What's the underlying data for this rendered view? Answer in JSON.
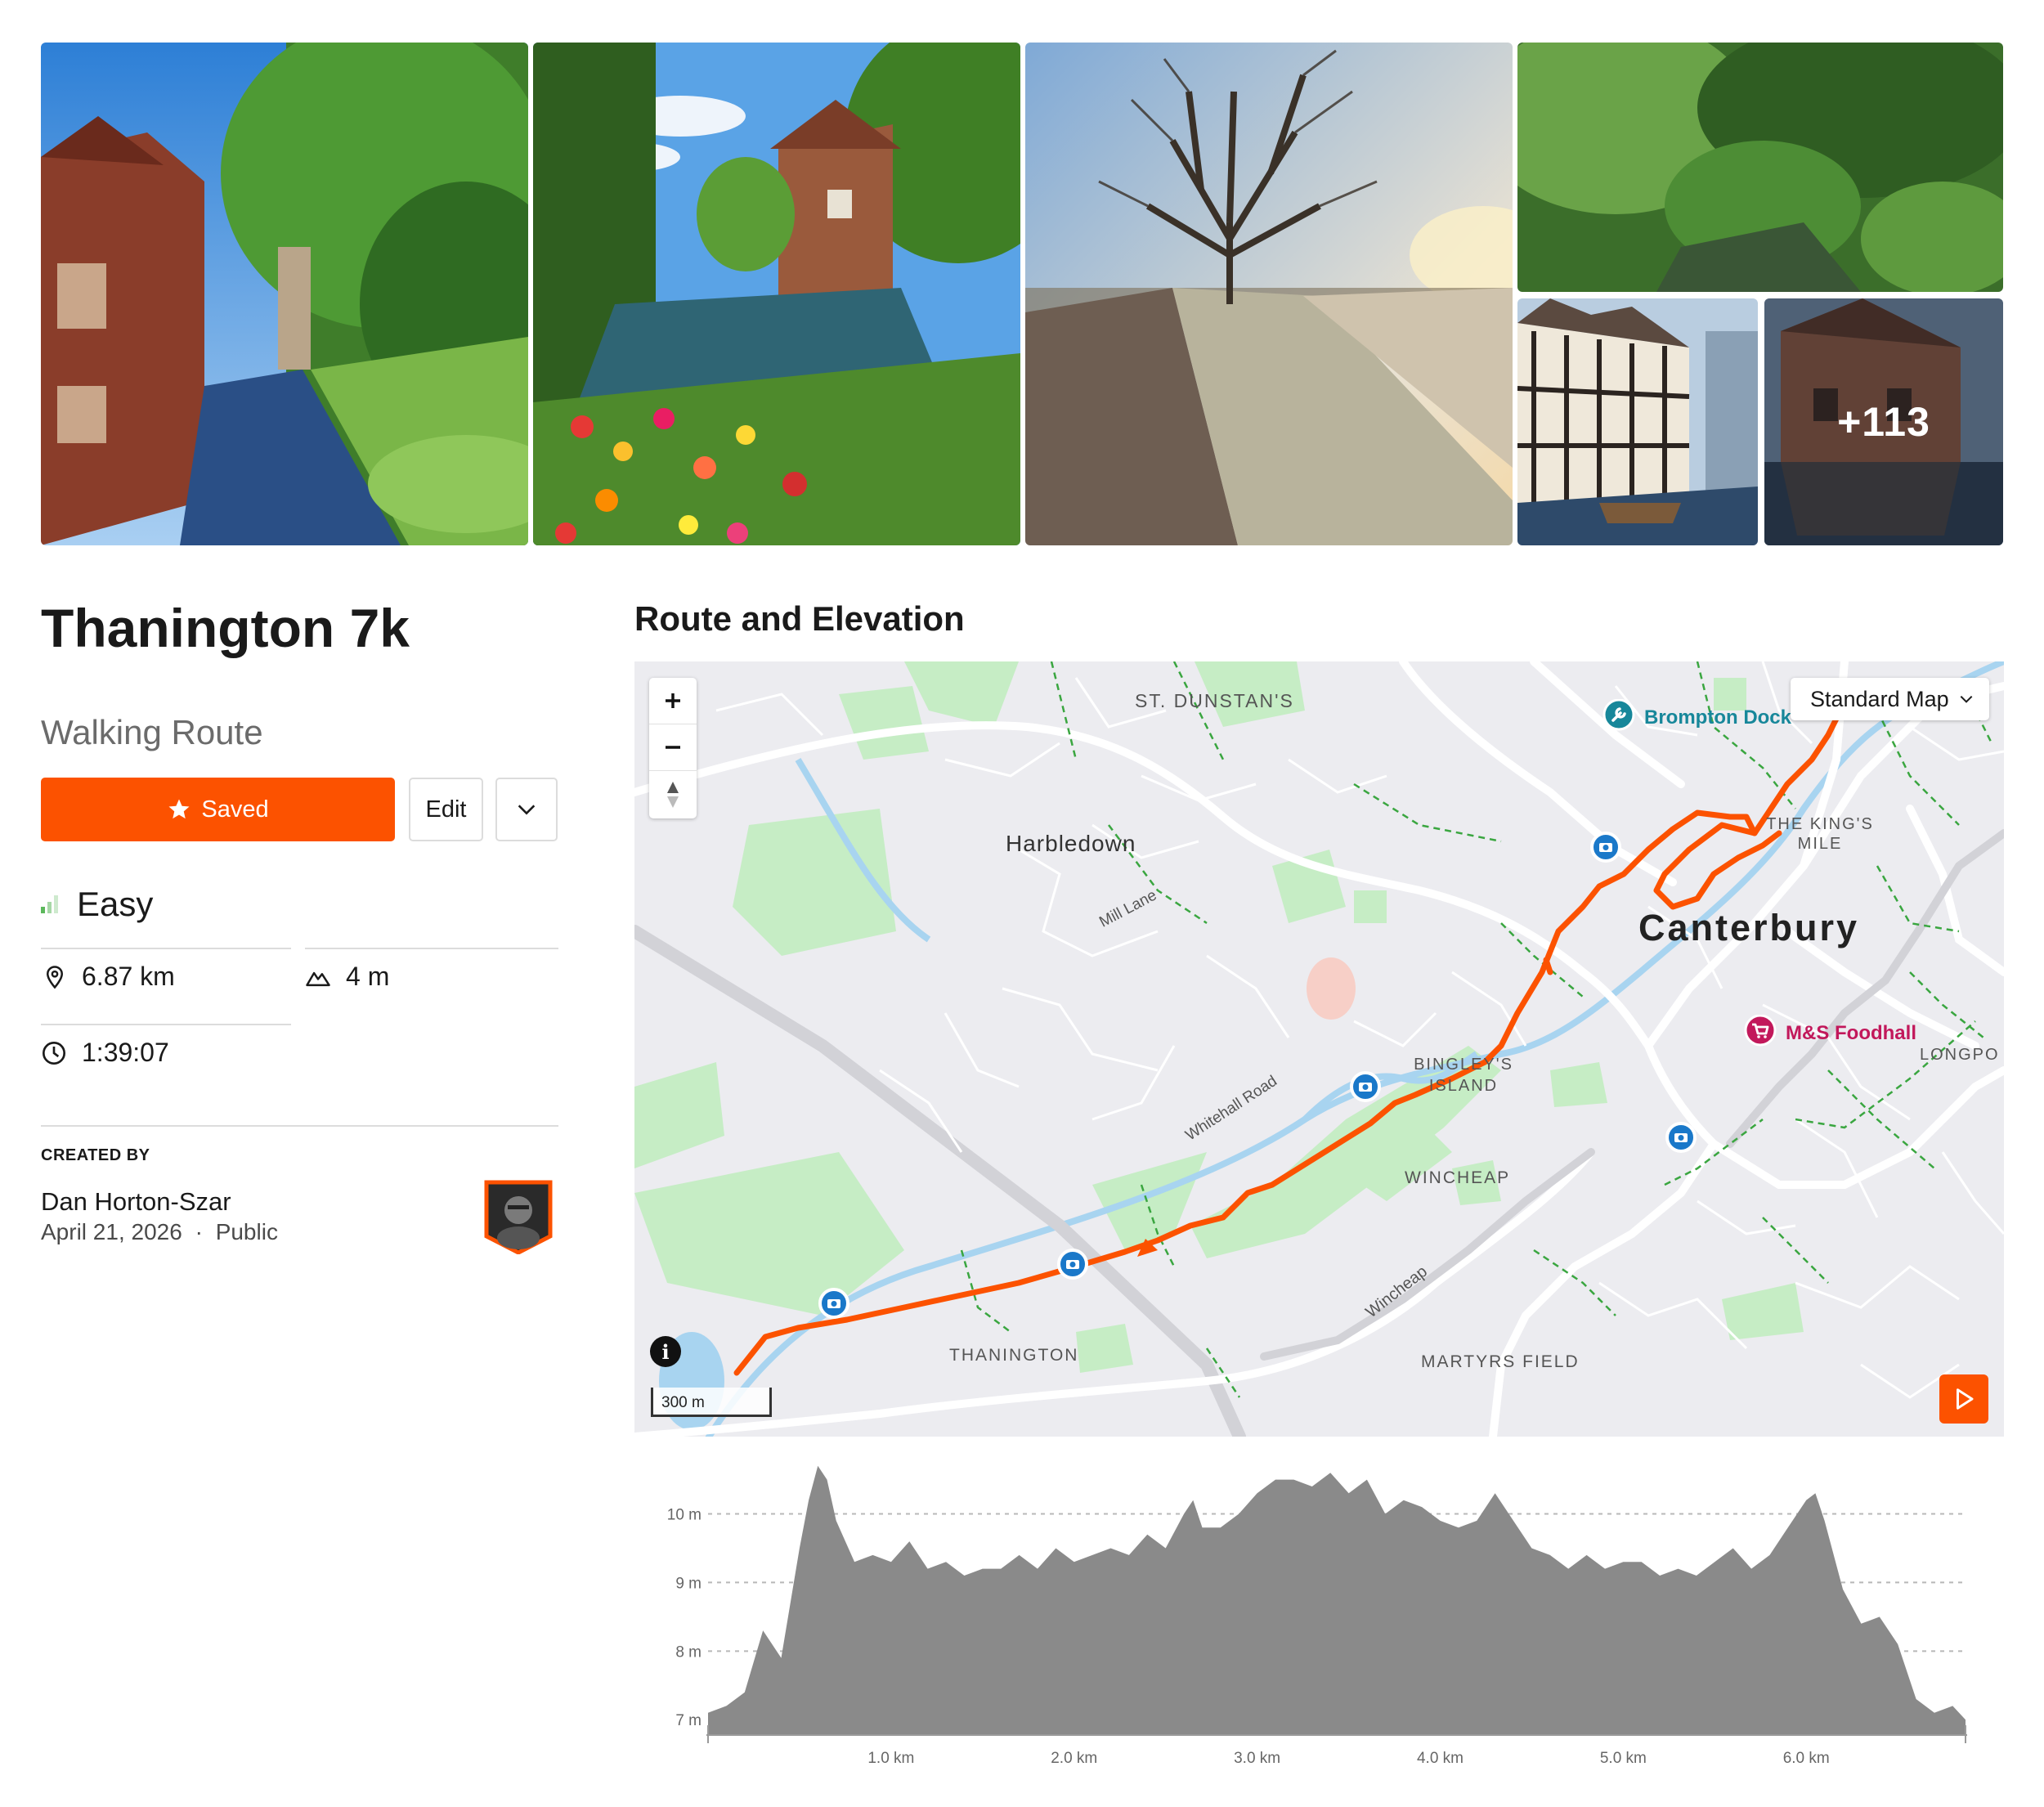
{
  "gallery": {
    "more_count": "+113",
    "photos": [
      {
        "alt_icon": "river-photo"
      },
      {
        "alt_icon": "garden-photo"
      },
      {
        "alt_icon": "tree-photo"
      },
      {
        "alt_icon": "stream-photo"
      },
      {
        "alt_icon": "tudor-house-photo"
      },
      {
        "alt_icon": "old-building-photo"
      }
    ]
  },
  "route": {
    "title": "Thanington 7k",
    "type": "Walking Route",
    "difficulty": "Easy",
    "distance": "6.87 km",
    "elevation_gain": "4 m",
    "duration": "1:39:07"
  },
  "actions": {
    "saved_label": "Saved",
    "edit_label": "Edit"
  },
  "creator": {
    "section_label": "CREATED BY",
    "name": "Dan Horton-Szar",
    "date": "April 21, 2026",
    "separator": "·",
    "visibility": "Public"
  },
  "map": {
    "section_title": "Route and Elevation",
    "style_label": "Standard Map",
    "scale_label": "300 m",
    "labels": {
      "st_dunstans": "ST. DUNSTAN'S",
      "harbledown": "Harbledown",
      "mill_lane": "Mill Lane",
      "canterbury": "Canterbury",
      "kings_mile": "THE KING'S MILE",
      "bingleys_island": "BINGLEY'S ISLAND",
      "whitehall_road": "Whitehall Road",
      "wincheap_area": "WINCHEAP",
      "wincheap_road": "Wincheap",
      "thanington": "THANINGTON",
      "martyrs_field": "MARTYRS FIELD",
      "longport": "LONGPO"
    },
    "pois": {
      "brompton_dock": "Brompton Dock",
      "ms_foodhall": "M&S Foodhall"
    },
    "route_color": "#fc5200"
  },
  "accent": {
    "orange": "#fc5200",
    "difficulty_green": "#5cb85c",
    "park_green": "#c6edc5",
    "water_blue": "#a8d4f0",
    "elevation_fill": "#8a8a8a"
  },
  "chart_data": {
    "type": "area",
    "title": "",
    "xlabel": "",
    "ylabel": "",
    "ylim": [
      6.8,
      10.9
    ],
    "xlim": [
      0,
      6.87
    ],
    "y_ticks": [
      "7 m",
      "8 m",
      "9 m",
      "10 m"
    ],
    "x_ticks": [
      "1.0 km",
      "2.0 km",
      "3.0 km",
      "4.0 km",
      "5.0 km",
      "6.0 km"
    ],
    "grid": true,
    "series": [
      {
        "x": [
          0,
          0.1,
          0.2,
          0.3,
          0.4,
          0.5,
          0.55,
          0.6,
          0.65,
          0.7,
          0.8,
          0.9,
          1.0,
          1.1,
          1.2,
          1.3,
          1.4,
          1.5,
          1.6,
          1.7,
          1.8,
          1.9,
          2.0,
          2.1,
          2.2,
          2.3,
          2.4,
          2.5,
          2.6,
          2.65,
          2.7,
          2.8,
          2.9,
          3.0,
          3.1,
          3.2,
          3.3,
          3.4,
          3.5,
          3.6,
          3.7,
          3.8,
          3.9,
          4.0,
          4.1,
          4.2,
          4.3,
          4.4,
          4.5,
          4.6,
          4.7,
          4.8,
          4.9,
          5.0,
          5.1,
          5.2,
          5.3,
          5.4,
          5.5,
          5.6,
          5.7,
          5.8,
          5.9,
          6.0,
          6.05,
          6.1,
          6.2,
          6.3,
          6.4,
          6.5,
          6.6,
          6.7,
          6.8,
          6.87
        ],
        "y": [
          7.1,
          7.2,
          7.4,
          8.3,
          7.9,
          9.5,
          10.2,
          10.7,
          10.5,
          9.9,
          9.3,
          9.4,
          9.3,
          9.6,
          9.2,
          9.3,
          9.1,
          9.2,
          9.2,
          9.4,
          9.2,
          9.5,
          9.3,
          9.4,
          9.5,
          9.4,
          9.7,
          9.5,
          10.0,
          10.2,
          9.8,
          9.8,
          10.0,
          10.3,
          10.5,
          10.5,
          10.4,
          10.6,
          10.3,
          10.5,
          10.0,
          10.2,
          10.1,
          9.9,
          9.8,
          9.9,
          10.3,
          9.9,
          9.5,
          9.4,
          9.2,
          9.4,
          9.2,
          9.3,
          9.3,
          9.1,
          9.2,
          9.1,
          9.3,
          9.5,
          9.2,
          9.4,
          9.8,
          10.2,
          10.3,
          9.9,
          8.9,
          8.4,
          8.5,
          8.1,
          7.3,
          7.1,
          7.2,
          7.0
        ]
      }
    ]
  }
}
